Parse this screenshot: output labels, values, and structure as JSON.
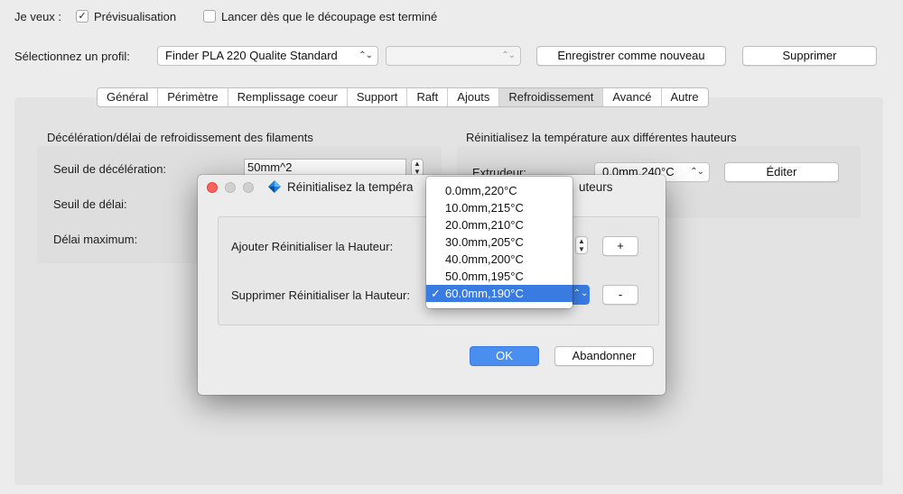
{
  "top": {
    "want_label": "Je veux :",
    "preview": {
      "label": "Prévisualisation",
      "checked": true
    },
    "launch": {
      "label": "Lancer dès que le découpage est terminé",
      "checked": false
    }
  },
  "profile": {
    "label": "Sélectionnez un profil:",
    "selected": "Finder PLA 220 Qualite Standard",
    "secondary": "",
    "save_new": "Enregistrer comme nouveau",
    "delete": "Supprimer"
  },
  "tabs": [
    "Général",
    "Périmètre",
    "Remplissage coeur",
    "Support",
    "Raft",
    "Ajouts",
    "Refroidissement",
    "Avancé",
    "Autre"
  ],
  "selected_tab": "Refroidissement",
  "left_panel": {
    "title": "Décélération/délai de refroidissement des filaments",
    "decel_label": "Seuil de décélération:",
    "decel_value": "50mm^2",
    "delay_label": "Seuil de délai:",
    "max_delay_label": "Délai maximum:"
  },
  "right_panel": {
    "title": "Réinitialisez la température aux différentes hauteurs",
    "extruder_label": "Extrudeur:",
    "extruder_value": "0.0mm,240°C",
    "edit_button": "Éditer"
  },
  "dialog": {
    "title": "Réinitialisez la tempéra",
    "title_tail": "uteurs",
    "add_label": "Ajouter Réinitialiser la Hauteur:",
    "add_button": "+",
    "remove_label": "Supprimer Réinitialiser la Hauteur:",
    "remove_button": "-",
    "ok": "OK",
    "cancel": "Abandonner"
  },
  "dropdown": {
    "options": [
      "0.0mm,220°C",
      "10.0mm,215°C",
      "20.0mm,210°C",
      "30.0mm,205°C",
      "40.0mm,200°C",
      "50.0mm,195°C",
      "60.0mm,190°C"
    ],
    "selected_index": 6
  },
  "colors": {
    "accent": "#3a7be2",
    "close": "#fc605c",
    "inactive_light": "#d0d0d0"
  }
}
